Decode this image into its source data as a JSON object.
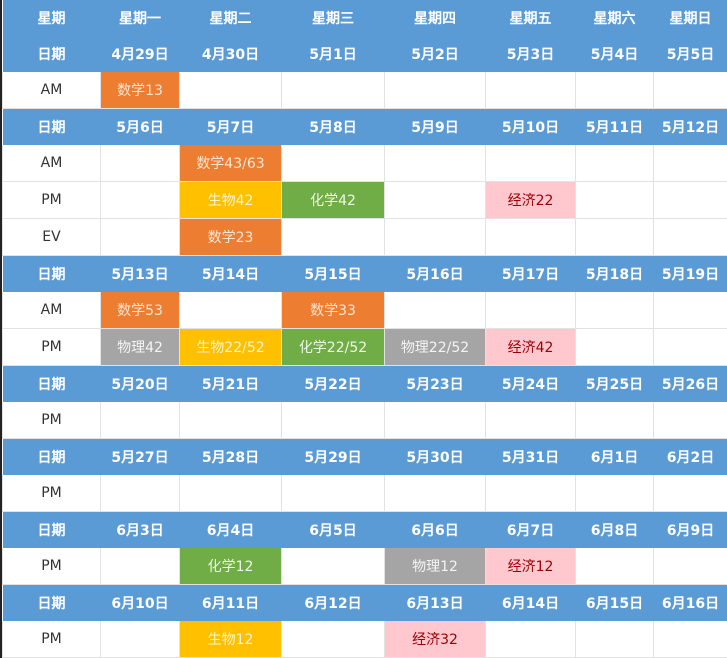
{
  "colors": {
    "header_bg": "#5b9bd5",
    "header_text": "#ffffff",
    "math": "#ed7d31",
    "biology": "#ffc000",
    "chemistry": "#70ad47",
    "physics": "#a5a5a5",
    "economics_bg": "#ffc7ce",
    "economics_text": "#9c0006"
  },
  "weekday_header": {
    "label": "星期",
    "days": [
      "星期一",
      "星期二",
      "星期三",
      "星期四",
      "星期五",
      "星期六",
      "星期日"
    ]
  },
  "weeks": [
    {
      "label": "日期",
      "dates": [
        "4月29日",
        "4月30日",
        "5月1日",
        "5月2日",
        "5月3日",
        "5月4日",
        "5月5日"
      ],
      "rows": [
        {
          "slot": "AM",
          "cells": [
            {
              "text": "数学13",
              "subject": "math"
            },
            {
              "text": "",
              "subject": ""
            },
            {
              "text": "",
              "subject": ""
            },
            {
              "text": "",
              "subject": ""
            },
            {
              "text": "",
              "subject": ""
            },
            {
              "text": "",
              "subject": ""
            },
            {
              "text": "",
              "subject": ""
            }
          ]
        }
      ]
    },
    {
      "label": "日期",
      "dates": [
        "5月6日",
        "5月7日",
        "5月8日",
        "5月9日",
        "5月10日",
        "5月11日",
        "5月12日"
      ],
      "rows": [
        {
          "slot": "AM",
          "cells": [
            {
              "text": "",
              "subject": ""
            },
            {
              "text": "数学43/63",
              "subject": "math"
            },
            {
              "text": "",
              "subject": ""
            },
            {
              "text": "",
              "subject": ""
            },
            {
              "text": "",
              "subject": ""
            },
            {
              "text": "",
              "subject": ""
            },
            {
              "text": "",
              "subject": ""
            }
          ]
        },
        {
          "slot": "PM",
          "cells": [
            {
              "text": "",
              "subject": ""
            },
            {
              "text": "生物42",
              "subject": "bio"
            },
            {
              "text": "化学42",
              "subject": "chem"
            },
            {
              "text": "",
              "subject": ""
            },
            {
              "text": "经济22",
              "subject": "econ"
            },
            {
              "text": "",
              "subject": ""
            },
            {
              "text": "",
              "subject": ""
            }
          ]
        },
        {
          "slot": "EV",
          "cells": [
            {
              "text": "",
              "subject": ""
            },
            {
              "text": "数学23",
              "subject": "math"
            },
            {
              "text": "",
              "subject": ""
            },
            {
              "text": "",
              "subject": ""
            },
            {
              "text": "",
              "subject": ""
            },
            {
              "text": "",
              "subject": ""
            },
            {
              "text": "",
              "subject": ""
            }
          ]
        }
      ]
    },
    {
      "label": "日期",
      "dates": [
        "5月13日",
        "5月14日",
        "5月15日",
        "5月16日",
        "5月17日",
        "5月18日",
        "5月19日"
      ],
      "rows": [
        {
          "slot": "AM",
          "cells": [
            {
              "text": "数学53",
              "subject": "math"
            },
            {
              "text": "",
              "subject": ""
            },
            {
              "text": "数学33",
              "subject": "math"
            },
            {
              "text": "",
              "subject": ""
            },
            {
              "text": "",
              "subject": ""
            },
            {
              "text": "",
              "subject": ""
            },
            {
              "text": "",
              "subject": ""
            }
          ]
        },
        {
          "slot": "PM",
          "cells": [
            {
              "text": "物理42",
              "subject": "phys"
            },
            {
              "text": "生物22/52",
              "subject": "bio"
            },
            {
              "text": "化学22/52",
              "subject": "chem"
            },
            {
              "text": "物理22/52",
              "subject": "phys"
            },
            {
              "text": "经济42",
              "subject": "econ"
            },
            {
              "text": "",
              "subject": ""
            },
            {
              "text": "",
              "subject": ""
            }
          ]
        }
      ]
    },
    {
      "label": "日期",
      "dates": [
        "5月20日",
        "5月21日",
        "5月22日",
        "5月23日",
        "5月24日",
        "5月25日",
        "5月26日"
      ],
      "rows": [
        {
          "slot": "PM",
          "cells": [
            {
              "text": "",
              "subject": ""
            },
            {
              "text": "",
              "subject": ""
            },
            {
              "text": "",
              "subject": ""
            },
            {
              "text": "",
              "subject": ""
            },
            {
              "text": "",
              "subject": ""
            },
            {
              "text": "",
              "subject": ""
            },
            {
              "text": "",
              "subject": ""
            }
          ]
        }
      ]
    },
    {
      "label": "日期",
      "dates": [
        "5月27日",
        "5月28日",
        "5月29日",
        "5月30日",
        "5月31日",
        "6月1日",
        "6月2日"
      ],
      "rows": [
        {
          "slot": "PM",
          "cells": [
            {
              "text": "",
              "subject": ""
            },
            {
              "text": "",
              "subject": ""
            },
            {
              "text": "",
              "subject": ""
            },
            {
              "text": "",
              "subject": ""
            },
            {
              "text": "",
              "subject": ""
            },
            {
              "text": "",
              "subject": ""
            },
            {
              "text": "",
              "subject": ""
            }
          ]
        }
      ]
    },
    {
      "label": "日期",
      "dates": [
        "6月3日",
        "6月4日",
        "6月5日",
        "6月6日",
        "6月7日",
        "6月8日",
        "6月9日"
      ],
      "rows": [
        {
          "slot": "PM",
          "cells": [
            {
              "text": "",
              "subject": ""
            },
            {
              "text": "化学12",
              "subject": "chem"
            },
            {
              "text": "",
              "subject": ""
            },
            {
              "text": "物理12",
              "subject": "phys"
            },
            {
              "text": "经济12",
              "subject": "econ"
            },
            {
              "text": "",
              "subject": ""
            },
            {
              "text": "",
              "subject": ""
            }
          ]
        }
      ]
    },
    {
      "label": "日期",
      "dates": [
        "6月10日",
        "6月11日",
        "6月12日",
        "6月13日",
        "6月14日",
        "6月15日",
        "6月16日"
      ],
      "rows": [
        {
          "slot": "PM",
          "cells": [
            {
              "text": "",
              "subject": ""
            },
            {
              "text": "生物12",
              "subject": "bio"
            },
            {
              "text": "",
              "subject": ""
            },
            {
              "text": "经济32",
              "subject": "econ"
            },
            {
              "text": "",
              "subject": ""
            },
            {
              "text": "",
              "subject": ""
            },
            {
              "text": "",
              "subject": ""
            }
          ]
        }
      ]
    }
  ]
}
